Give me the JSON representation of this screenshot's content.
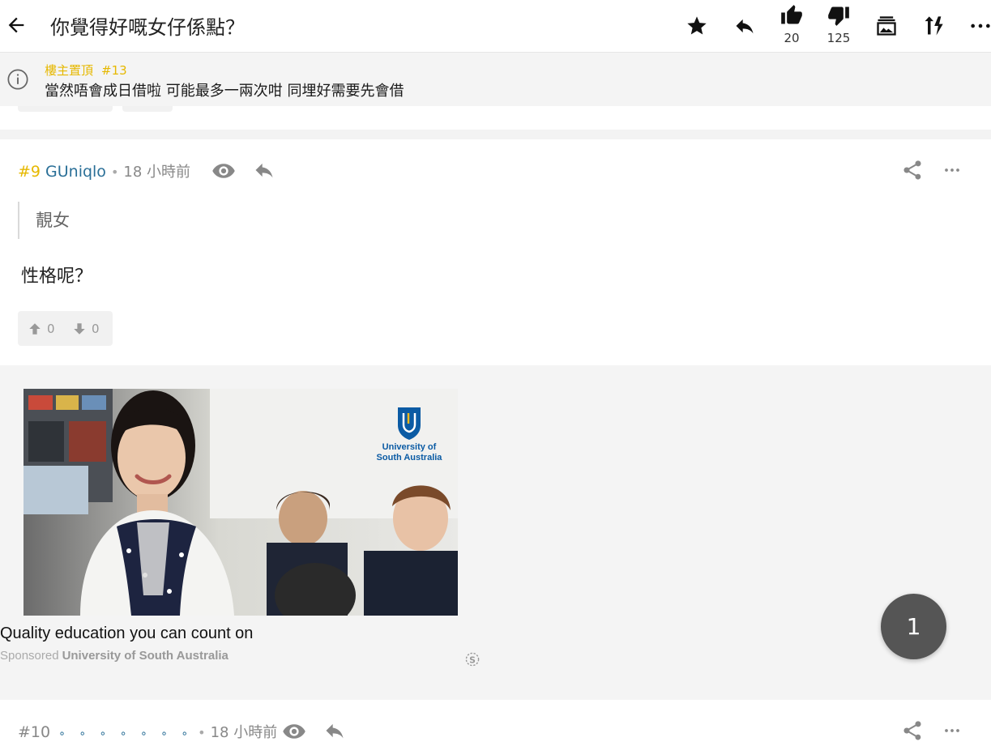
{
  "topbar": {
    "title": "你覺得好嘅女仔係點？",
    "like_count": "20",
    "dislike_count": "125"
  },
  "pinned": {
    "label": "樓主置頂",
    "reply_number": "#13",
    "text": "當然唔會成日借啦 可能最多一兩次咁 同埋好需要先會借"
  },
  "posts": [
    {
      "floor": "#9",
      "username": "GUniqlo",
      "separator": "•",
      "time": "18 小時前",
      "quote": "靚女",
      "content": "性格呢？",
      "upvotes": "0",
      "downvotes": "0"
    },
    {
      "floor": "#10",
      "username": "∘ ∘ ∘ ∘ ∘ ∘ ∘",
      "separator": "•",
      "time": "18 小時前"
    }
  ],
  "ad": {
    "logo_line1": "University of",
    "logo_line2": "South Australia",
    "title": "Quality education you can count on",
    "sponsored_label": "Sponsored",
    "advertiser": "University of South Australia",
    "brand_color": "#0b5ba4"
  },
  "pagination": {
    "current_page": "1"
  },
  "icons": {
    "back": "arrow-left-icon",
    "favorite": "star-icon",
    "reply": "reply-icon",
    "like": "thumbs-up-icon",
    "dislike": "thumbs-down-icon",
    "gallery": "image-gallery-icon",
    "sort": "sort-icon",
    "more": "more-horizontal-icon",
    "info": "info-icon",
    "eye": "eye-icon",
    "share": "share-icon",
    "upvote": "arrow-up-icon",
    "downvote": "arrow-down-icon",
    "ad_options": "settings-dollar-icon"
  }
}
